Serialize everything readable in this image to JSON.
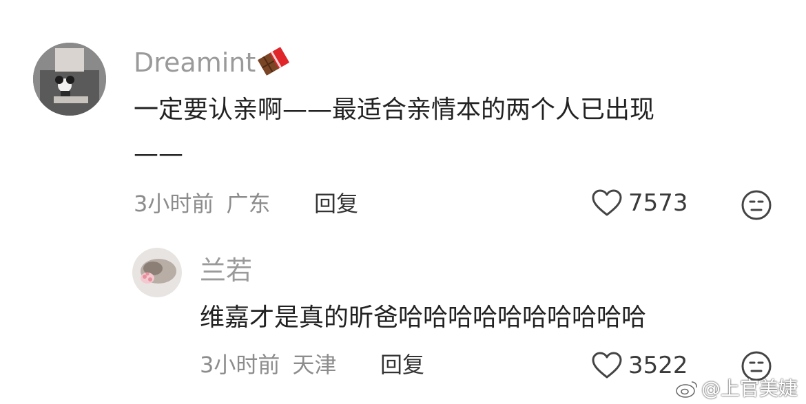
{
  "comment": {
    "username": "Dreamint",
    "username_emoji": "chocolate-bar",
    "text_line1": "一定要认亲啊——最适合亲情本的两个人已出现",
    "text_line2": "——",
    "time": "3小时前",
    "location": "广东",
    "reply_label": "回复",
    "likes": "7573",
    "reaction_icon": "neutral-face-icon"
  },
  "reply": {
    "username": "兰若",
    "text": "维嘉才是真的昕爸哈哈哈哈哈哈哈哈哈哈",
    "time": "3小时前",
    "location": "天津",
    "reply_label": "回复",
    "likes": "3522",
    "reaction_icon": "neutral-face-icon"
  },
  "watermark": {
    "text": "@上官美婕"
  },
  "colors": {
    "username": "#9a9a9a",
    "meta": "#8c8c8c",
    "text": "#222222"
  }
}
